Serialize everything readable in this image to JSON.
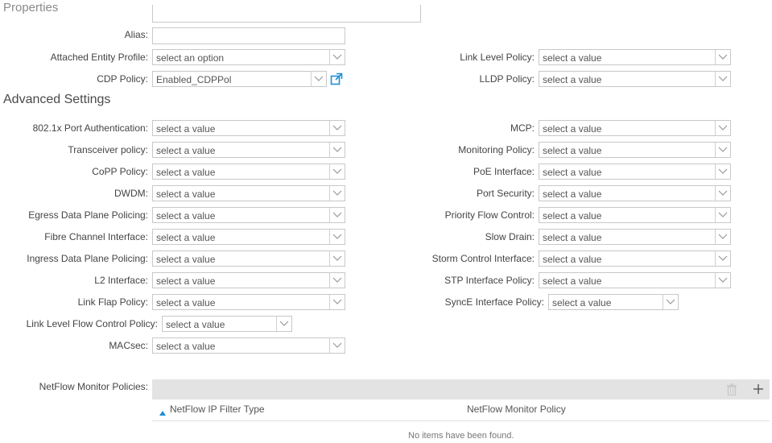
{
  "sections": {
    "properties": "Properties",
    "advanced": "Advanced Settings"
  },
  "fields": {
    "alias": {
      "label": "Alias:",
      "value": ""
    },
    "attached_entity_profile": {
      "label": "Attached Entity Profile:",
      "value": "select an option"
    },
    "cdp_policy": {
      "label": "CDP Policy:",
      "value": "Enabled_CDPPol"
    },
    "link_level_policy": {
      "label": "Link Level Policy:",
      "value": "select a value"
    },
    "lldp_policy": {
      "label": "LLDP Policy:",
      "value": "select a value"
    }
  },
  "advanced_left": [
    {
      "label": "802.1x Port Authentication:",
      "value": "select a value"
    },
    {
      "label": "Transceiver policy:",
      "value": "select a value"
    },
    {
      "label": "CoPP Policy:",
      "value": "select a value"
    },
    {
      "label": "DWDM:",
      "value": "select a value"
    },
    {
      "label": "Egress Data Plane Policing:",
      "value": "select a value"
    },
    {
      "label": "Fibre Channel Interface:",
      "value": "select a value"
    },
    {
      "label": "Ingress Data Plane Policing:",
      "value": "select a value"
    },
    {
      "label": "L2 Interface:",
      "value": "select a value"
    },
    {
      "label": "Link Flap Policy:",
      "value": "select a value"
    },
    {
      "label": "Link Level Flow Control Policy:",
      "value": "select a value"
    },
    {
      "label": "MACsec:",
      "value": "select a value"
    }
  ],
  "advanced_right": [
    {
      "label": "MCP:",
      "value": "select a value"
    },
    {
      "label": "Monitoring Policy:",
      "value": "select a value"
    },
    {
      "label": "PoE Interface:",
      "value": "select a value"
    },
    {
      "label": "Port Security:",
      "value": "select a value"
    },
    {
      "label": "Priority Flow Control:",
      "value": "select a value"
    },
    {
      "label": "Slow Drain:",
      "value": "select a value"
    },
    {
      "label": "Storm Control Interface:",
      "value": "select a value"
    },
    {
      "label": "STP Interface Policy:",
      "value": "select a value"
    },
    {
      "label": "SyncE Interface Policy:",
      "value": "select a value"
    }
  ],
  "netflow": {
    "label": "NetFlow Monitor Policies:",
    "columns": [
      "NetFlow IP Filter Type",
      "NetFlow Monitor Policy"
    ],
    "empty_message": "No items have been found.",
    "sort_icon": "sort-ascending-icon",
    "delete_icon": "trash-icon",
    "add_icon": "plus-icon"
  },
  "colors": {
    "accent": "#1b8fd4",
    "border": "#c8c8c8",
    "toolbar_bg": "#e3e3e3"
  }
}
